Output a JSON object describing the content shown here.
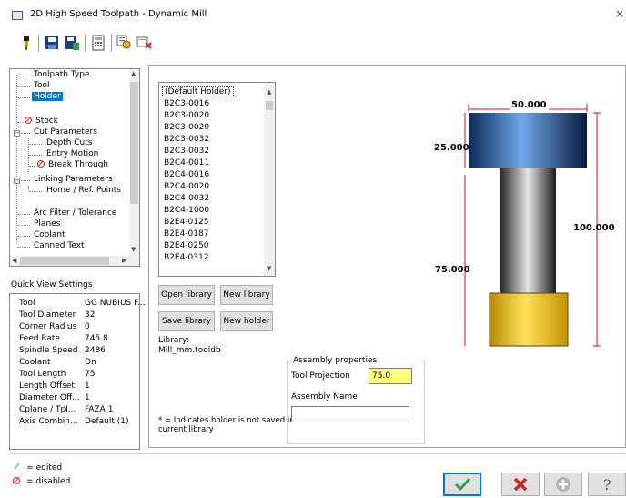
{
  "window": {
    "title": "2D High Speed Toolpath - Dynamic Mill",
    "close_glyph": "×"
  },
  "toolbar": {
    "icons": [
      "toolpath-icon",
      "save-icon",
      "save-as-icon",
      "calculator-icon",
      "preview-icon",
      "reset-icon"
    ]
  },
  "tree": {
    "items": [
      {
        "label": "Toolpath Type"
      },
      {
        "label": "Tool"
      },
      {
        "label": "Holder"
      },
      {
        "label": "Stock"
      },
      {
        "label": "Cut Parameters"
      },
      {
        "label": "Depth Cuts"
      },
      {
        "label": "Entry Motion"
      },
      {
        "label": "Break Through"
      },
      {
        "label": "Linking Parameters"
      },
      {
        "label": "Home / Ref. Points"
      },
      {
        "label": "Arc Filter / Tolerance"
      },
      {
        "label": "Planes"
      },
      {
        "label": "Coolant"
      },
      {
        "label": "Canned Text"
      }
    ],
    "selected": "Holder"
  },
  "quick_view": {
    "label": "Quick View Settings",
    "rows": [
      {
        "key": "Tool",
        "value": "GG NUBIUS F..."
      },
      {
        "key": "Tool Diameter",
        "value": "32"
      },
      {
        "key": "Corner Radius",
        "value": "0"
      },
      {
        "key": "Feed Rate",
        "value": "745.8"
      },
      {
        "key": "Spindle Speed",
        "value": "2486"
      },
      {
        "key": "Coolant",
        "value": "On"
      },
      {
        "key": "Tool Length",
        "value": "75"
      },
      {
        "key": "Length Offset",
        "value": "1"
      },
      {
        "key": "Diameter Off...",
        "value": "1"
      },
      {
        "key": "Cplane / Tpl...",
        "value": "FAZA 1"
      },
      {
        "key": "Axis Combin...",
        "value": "Default (1)"
      }
    ]
  },
  "legend": {
    "edited": "= edited",
    "disabled": "= disabled"
  },
  "holders": {
    "items": [
      "(Default Holder)",
      "B2C3-0016",
      "B2C3-0020",
      "B2C3-0020",
      "B2C3-0032",
      "B2C3-0032",
      "B2C4-0011",
      "B2C4-0016",
      "B2C4-0020",
      "B2C4-0032",
      "B2C4-1000",
      "B2E4-0125",
      "B2E4-0187",
      "B2E4-0250",
      "B2E4-0312"
    ],
    "selected": "(Default Holder)"
  },
  "buttons": {
    "open_library": "Open library",
    "new_library": "New library",
    "save_library": "Save library",
    "new_holder": "New holder"
  },
  "library": {
    "label": "Library:",
    "file": "Mill_mm.tooldb"
  },
  "note": "* = Indicates holder is not saved in current library",
  "assembly": {
    "title": "Assembly properties",
    "tool_projection_label": "Tool Projection",
    "tool_projection_value": "75.0",
    "assembly_name_label": "Assembly Name",
    "assembly_name_value": ""
  },
  "dimensions": {
    "top_width": "50.000",
    "holder_height": "25.000",
    "total_height": "100.000",
    "projection": "75.000"
  },
  "colors": {
    "holder_blue": "#1f5fa8",
    "tool_yellow": "#f2c20a",
    "dim_red": "#c4161c",
    "selection": "#0078d7"
  }
}
